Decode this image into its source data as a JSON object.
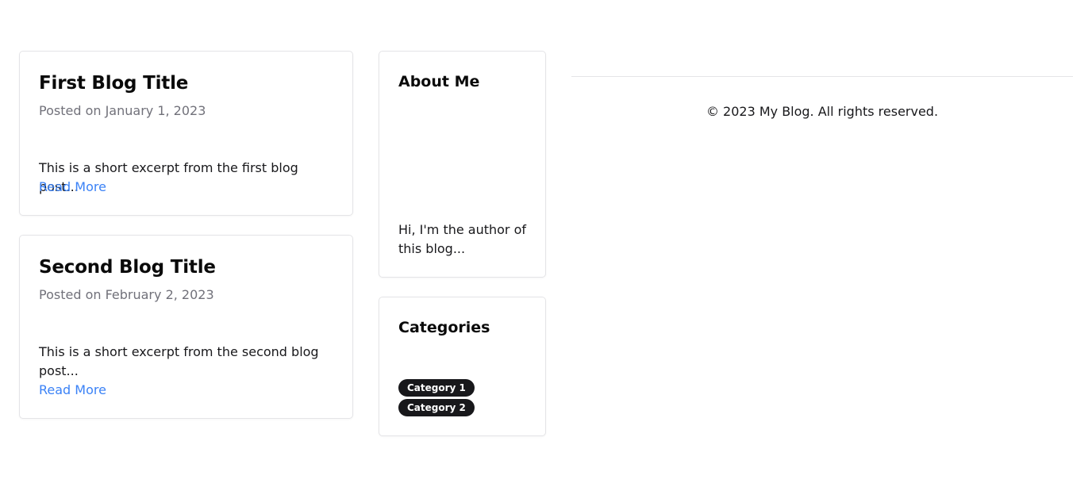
{
  "posts": [
    {
      "title": "First Blog Title",
      "date": "Posted on January 1, 2023",
      "excerpt": "This is a short excerpt from the first blog post...",
      "link": "Read More"
    },
    {
      "title": "Second Blog Title",
      "date": "Posted on February 2, 2023",
      "excerpt": "This is a short excerpt from the second blog post...",
      "link": "Read More"
    }
  ],
  "about": {
    "title": "About Me",
    "text": "Hi, I'm the author of this blog..."
  },
  "categories": {
    "title": "Categories",
    "items": [
      "Category 1",
      "Category 2"
    ]
  },
  "footer": {
    "text": "© 2023 My Blog. All rights reserved."
  },
  "colors": {
    "link": "#3b82f6",
    "badge_bg": "#18181b",
    "muted": "#71717a",
    "border": "#e4e4e7"
  }
}
